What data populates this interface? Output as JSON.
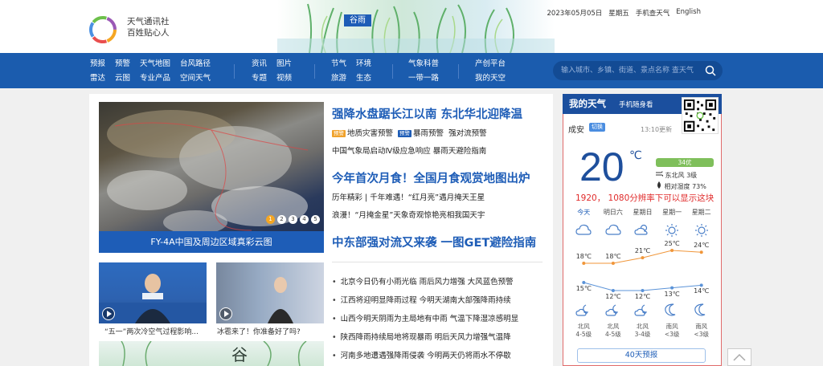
{
  "header": {
    "brand_line1": "天气通讯社",
    "brand_line2": "百姓贴心人",
    "banner_badge": "谷雨",
    "date": "2023年05月05日",
    "weekday": "星期五",
    "mobile": "手机查天气",
    "english": "English"
  },
  "nav": {
    "group1": [
      "预报",
      "雷达",
      "预警",
      "云图",
      "天气地图",
      "专业产品",
      "台风路径",
      "空间天气"
    ],
    "group2": [
      "资讯",
      "专题",
      "图片",
      "视频"
    ],
    "group3": [
      "节气",
      "旅游",
      "环境",
      "生态"
    ],
    "group4": [
      "气象科普",
      "一带一路"
    ],
    "group5": [
      "产创平台",
      "我的天空"
    ],
    "search_placeholder": "输入城市、乡镇、街道、景点名称 查天气"
  },
  "hero": {
    "caption": "FY-4A中国及周边区域真彩云图",
    "pages": [
      "1",
      "2",
      "3",
      "4",
      "5"
    ]
  },
  "thumbs": [
    {
      "caption": "“五一”两次冷空气过程影响..."
    },
    {
      "caption": "冰雹来了！你准备好了吗?"
    }
  ],
  "headlines": {
    "h1": "强降水盘踞长江以南 东北华北迎降温",
    "h1_tag1": "预警",
    "h1_item1": "地质灾害预警",
    "h1_tag2": "预警",
    "h1_item2": "暴雨预警",
    "h1_item3": "强对流预警",
    "h1_line2": "中国气象局启动Ⅳ级应急响应 暴雨天避险指南",
    "h2": "今年首次月食！全国月食观赏地图出炉",
    "h2_line1": "历年精彩 | 千年难遇！“红月亮”遇月掩天王星",
    "h2_line2": "浪漫！“月掩金星”天象奇观惊艳亮相我国天宇",
    "h3": "中东部强对流又来袭 一图GET避险指南"
  },
  "news": [
    "北京今日仍有小雨光临 雨后风力增强  大风蓝色预警",
    "江西将迎明显降雨过程  今明天湖南大部强降雨持续",
    "山西今明天阴雨为主局地有中雨  气温下降湿凉感明显",
    "陕西降雨持续局地将现暴雨 明后天风力增强气温降",
    "河南多地遭遇强降雨侵袭  今明两天仍将雨水不停歇"
  ],
  "weather": {
    "title": "我的天气",
    "mobile_label": "手机随身看",
    "city": "成安",
    "switch_label": "切换",
    "updated": "13:10更新",
    "temp": "20",
    "unit": "℃",
    "aqi": "34优",
    "wind": "东北风 3级",
    "humidity": "相对湿度 73%",
    "notice": "1920， 1080分辨率下可以显示这块",
    "days": [
      "今天",
      "明日六",
      "星期日",
      "星期一",
      "星期二"
    ],
    "highs": [
      "18℃",
      "18℃",
      "21℃",
      "25℃",
      "24℃"
    ],
    "lows": [
      "15℃",
      "12℃",
      "12℃",
      "13℃",
      "14℃"
    ],
    "high_values": [
      18,
      18,
      21,
      25,
      24
    ],
    "low_values": [
      15,
      12,
      12,
      13,
      14
    ],
    "wind_dir": [
      "北风",
      "北风",
      "北风",
      "南风",
      "南风"
    ],
    "wind_level": [
      "4-5级",
      "4-5级",
      "3-4级",
      "<3级",
      "<3级"
    ],
    "forecast_button": "40天预报",
    "colors": {
      "high_line": "#f0963a",
      "low_line": "#5b93d8"
    }
  }
}
